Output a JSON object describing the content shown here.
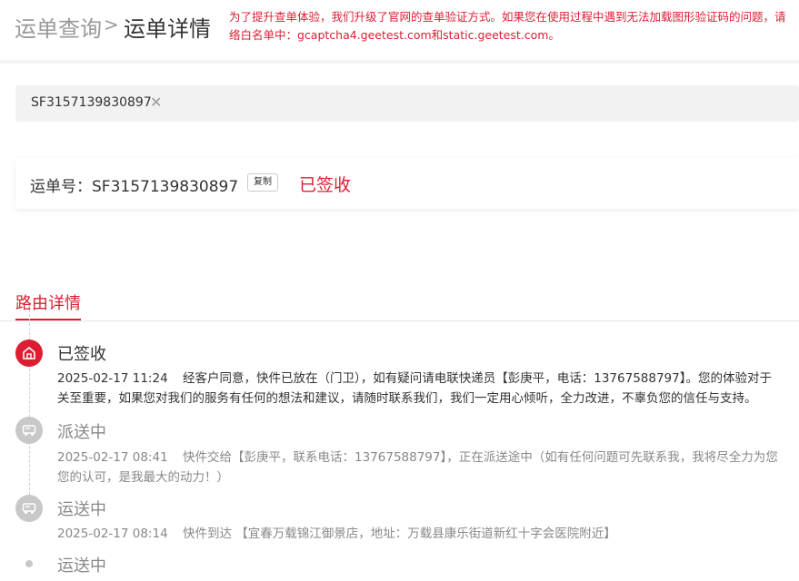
{
  "breadcrumb": {
    "root": "运单查询",
    "separator": ">",
    "current": "运单详情"
  },
  "notice": {
    "line1": "为了提升查单体验，我们升级了官网的查单验证方式。如果您在使用过程中遇到无法加载图形验证码的问题，请",
    "line2": "络白名单中：gcaptcha4.geetest.com和static.geetest.com。"
  },
  "search": {
    "tag": "SF3157139830897",
    "clear_icon": "✕"
  },
  "waybill": {
    "label": "运单号：SF3157139830897",
    "copy_label": "复制",
    "status": "已签收"
  },
  "route_tab": "路由详情",
  "colors": {
    "accent": "#dc1e32",
    "muted": "#c8c8c8"
  },
  "timeline": [
    {
      "title": "已签收",
      "icon": "house-icon",
      "time": "2025-02-17 11:24",
      "text_line1": "经客户同意，快件已放在（门卫），如有疑问请电联快递员【彭庚平，电话：13767588797】。您的体验对于",
      "text_line2": "关至重要，如果您对我们的服务有任何的想法和建议，请随时联系我们，我们一定用心倾听，全力改进，不辜负您的信任与支持。"
    },
    {
      "title": "派送中",
      "icon": "truck-icon",
      "time": "2025-02-17 08:41",
      "text_line1": "快件交给【彭庚平，联系电话：13767588797】，正在派送途中（如有任何问题可先联系我，我将尽全力为您",
      "text_line2": "您的认可，是我最大的动力！）"
    },
    {
      "title": "运送中",
      "icon": "truck-icon",
      "time": "2025-02-17 08:14",
      "text_line1": "快件到达 【宜春万载锦江御景店，地址：万载县康乐街道新红十字会医院附近】"
    },
    {
      "title": "运送中"
    }
  ]
}
